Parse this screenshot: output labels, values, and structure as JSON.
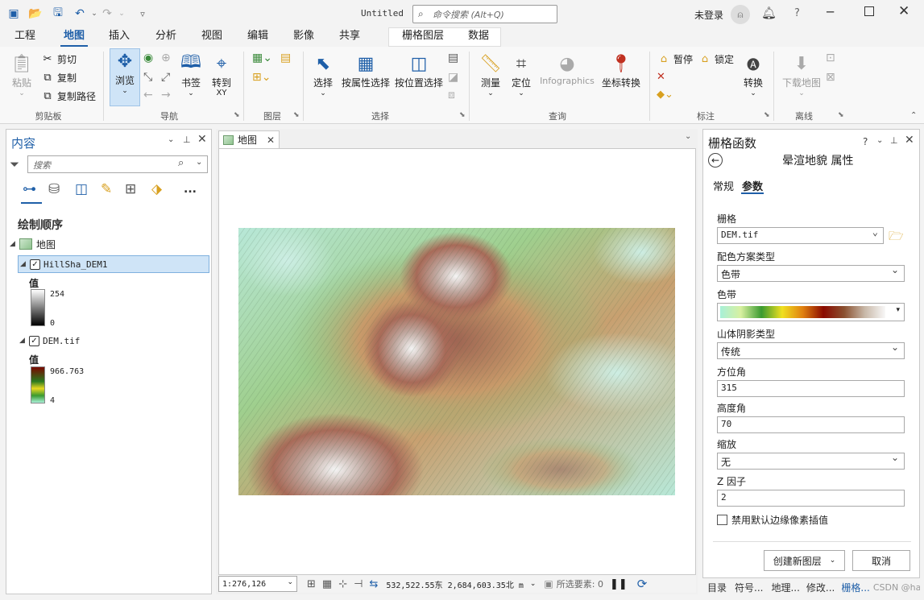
{
  "window": {
    "title": "Untitled",
    "search_placeholder": "命令搜索 (Alt+Q)",
    "user": "未登录",
    "help": "?"
  },
  "ribbon_tabs": [
    "工程",
    "地图",
    "插入",
    "分析",
    "视图",
    "编辑",
    "影像",
    "共享"
  ],
  "context_tabs": [
    "栅格图层",
    "数据"
  ],
  "ribbon": {
    "clipboard": {
      "paste": "粘贴",
      "cut": "剪切",
      "copy": "复制",
      "copy_path": "复制路径",
      "group": "剪贴板"
    },
    "navigate": {
      "explore": "浏览",
      "bookmarks": "书签",
      "goto": "转到",
      "goto_sub": "XY",
      "group": "导航"
    },
    "layer": {
      "group": "图层"
    },
    "selection": {
      "select": "选择",
      "by_attr": "按属性选择",
      "by_loc": "按位置选择",
      "group": "选择"
    },
    "inquiry": {
      "measure": "测量",
      "locate": "定位",
      "infographics": "Infographics",
      "convert_coords": "坐标转换",
      "group": "查询"
    },
    "labeling": {
      "pause": "暂停",
      "lock": "锁定",
      "convert": "转换",
      "group": "标注"
    },
    "offline": {
      "download": "下载地图",
      "group": "离线"
    }
  },
  "contents": {
    "title": "内容",
    "search_placeholder": "搜索",
    "more": "...",
    "draw_order": "绘制顺序",
    "map_name": "地图",
    "layers": [
      {
        "name": "HillSha_DEM1",
        "value_label": "值",
        "max": "254",
        "min": "0",
        "checked": true,
        "selected": true
      },
      {
        "name": "DEM.tif",
        "value_label": "值",
        "max": "966.763",
        "min": "4",
        "checked": true,
        "selected": false
      }
    ]
  },
  "map_view": {
    "tab": "地图",
    "scale": "1:276,126",
    "coords": "532,522.55东 2,684,603.35北 m",
    "selected_features": "所选要素: 0"
  },
  "raster_function": {
    "title": "栅格函数",
    "subtitle": "晕渲地貌 属性",
    "tabs": [
      "常规",
      "参数"
    ],
    "active_tab": "参数",
    "raster_label": "栅格",
    "raster_value": "DEM.tif",
    "color_scheme_type_label": "配色方案类型",
    "color_scheme_type_value": "色带",
    "color_ramp_label": "色带",
    "color_ramp_colors": [
      "#a8f0d8",
      "#d8f0a0",
      "#3a9a30",
      "#f0e020",
      "#e08010",
      "#8a0a00",
      "#8a5030",
      "#c8b8a8",
      "#f8f8f8"
    ],
    "hillshade_type_label": "山体阴影类型",
    "hillshade_type_value": "传统",
    "azimuth_label": "方位角",
    "azimuth_value": "315",
    "altitude_label": "高度角",
    "altitude_value": "70",
    "scaling_label": "缩放",
    "scaling_value": "无",
    "zfactor_label": "Z 因子",
    "zfactor_value": "2",
    "disable_edge_label": "禁用默认边缘像素插值",
    "create_button": "创建新图层",
    "cancel_button": "取消"
  },
  "bottom_tabs": [
    "目录",
    "符号...",
    "地理...",
    "修改...",
    "栅格...",
    "CSDN @haix先森"
  ]
}
